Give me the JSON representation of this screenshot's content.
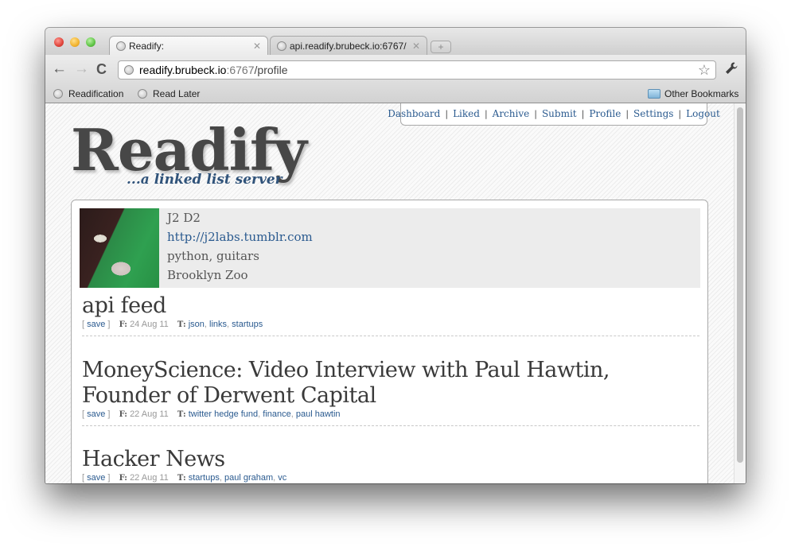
{
  "browser": {
    "tabs": [
      {
        "title": "Readify:",
        "active": true
      },
      {
        "title": "api.readify.brubeck.io:6767/",
        "active": false
      }
    ],
    "new_tab_glyph": "+",
    "close_glyph": "✕",
    "nav": {
      "back": "←",
      "forward": "→",
      "reload": "C"
    },
    "address": {
      "host": "readify.brubeck.io",
      "port": ":6767",
      "path": "/profile"
    },
    "star_glyph": "☆",
    "wrench_glyph": "🔧",
    "bookmarks": [
      {
        "label": "Readification"
      },
      {
        "label": "Read Later"
      }
    ],
    "other_bookmarks": "Other Bookmarks"
  },
  "site": {
    "nav": [
      {
        "label": "Dashboard"
      },
      {
        "label": "Liked"
      },
      {
        "label": "Archive"
      },
      {
        "label": "Submit"
      },
      {
        "label": "Profile"
      },
      {
        "label": "Settings"
      },
      {
        "label": "Logout"
      }
    ],
    "nav_separator": "|",
    "logo": "Readify",
    "tagline": "...a linked list server"
  },
  "profile": {
    "name": "J2 D2",
    "url": "http://j2labs.tumblr.com",
    "interests": "python, guitars",
    "location": "Brooklyn Zoo"
  },
  "entries": [
    {
      "title": "api feed",
      "save_label": "save",
      "from_label": "F:",
      "date": "24 Aug 11",
      "tags_label": "T:",
      "tags": [
        "json",
        "links",
        "startups"
      ]
    },
    {
      "title": "MoneyScience: Video Interview with Paul Hawtin, Founder of Derwent Capital",
      "save_label": "save",
      "from_label": "F:",
      "date": "22 Aug 11",
      "tags_label": "T:",
      "tags": [
        "twitter hedge fund",
        "finance",
        "paul hawtin"
      ]
    },
    {
      "title": "Hacker News",
      "save_label": "save",
      "from_label": "F:",
      "date": "22 Aug 11",
      "tags_label": "T:",
      "tags": [
        "startups",
        "paul graham",
        "vc"
      ]
    }
  ],
  "colors": {
    "link": "#2a5a8f",
    "logo": "#474747",
    "tagline": "#30537a"
  }
}
